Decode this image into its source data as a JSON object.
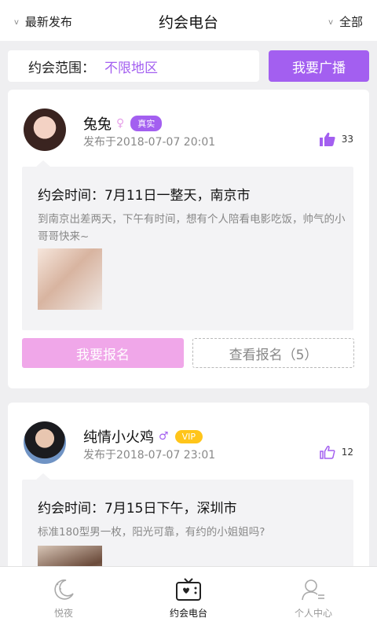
{
  "header": {
    "left_label": "最新发布",
    "title": "约会电台",
    "right_label": "全部",
    "chevron_glyph": "v"
  },
  "filter": {
    "range_label": "约会范围：",
    "range_value": "不限地区",
    "broadcast_label": "我要广播"
  },
  "posts": [
    {
      "name": "兔兔",
      "gender": "female",
      "gender_glyph": "♀",
      "badge": "真实",
      "posted": "发布于2018-07-07 20:01",
      "likes": "33",
      "date_time": "约会时间：7月11日一整天，南京市",
      "description": "到南京出差两天，下午有时间，想有个人陪看电影吃饭，帅气的小哥哥快来~",
      "signup_label": "我要报名",
      "view_label": "查看报名（5）"
    },
    {
      "name": "纯情小火鸡",
      "gender": "male",
      "gender_glyph": "♂",
      "badge": "VIP",
      "posted": "发布于2018-07-07 23:01",
      "likes": "12",
      "date_time": "约会时间：7月15日下午，深圳市",
      "description": "标准180型男一枚，阳光可靠，有约的小姐姐吗?"
    }
  ],
  "tabs": [
    {
      "label": "悦夜",
      "icon": "moon-icon"
    },
    {
      "label": "约会电台",
      "icon": "radio-icon",
      "active": true
    },
    {
      "label": "个人中心",
      "icon": "person-icon"
    }
  ],
  "colors": {
    "accent": "#a35ff0",
    "pink": "#f0a7e9",
    "vip": "#ffc51a"
  }
}
